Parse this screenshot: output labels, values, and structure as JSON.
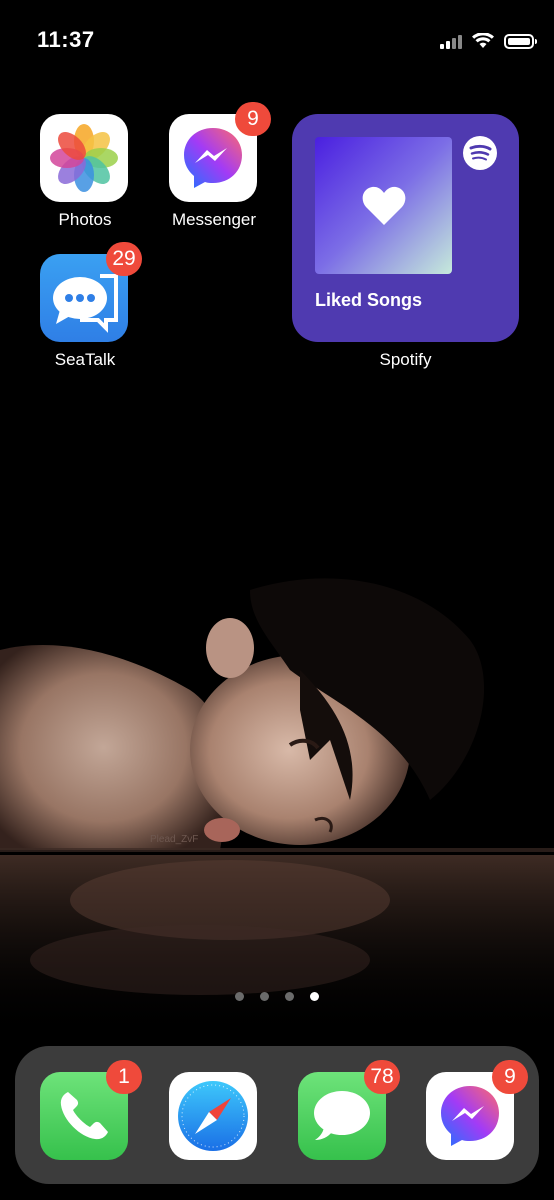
{
  "status_bar": {
    "time": "11:37"
  },
  "home_apps": [
    {
      "label": "Photos",
      "badge": ""
    },
    {
      "label": "Messenger",
      "badge": "9"
    },
    {
      "label": "SeaTalk",
      "badge": "29"
    }
  ],
  "spotify_widget": {
    "title": "Liked Songs",
    "label": "Spotify"
  },
  "wallpaper": {
    "watermark": "Plead_ZvF"
  },
  "page_dots": {
    "count": 4,
    "active_index": 3
  },
  "dock": [
    {
      "app": "Phone",
      "badge": "1"
    },
    {
      "app": "Safari",
      "badge": ""
    },
    {
      "app": "Messages",
      "badge": "78"
    },
    {
      "app": "Messenger",
      "badge": "9"
    }
  ],
  "colors": {
    "badge": "#ef4a3b",
    "spotify_widget_bg": "#4f3ab0",
    "dock_bg": "#464646"
  }
}
